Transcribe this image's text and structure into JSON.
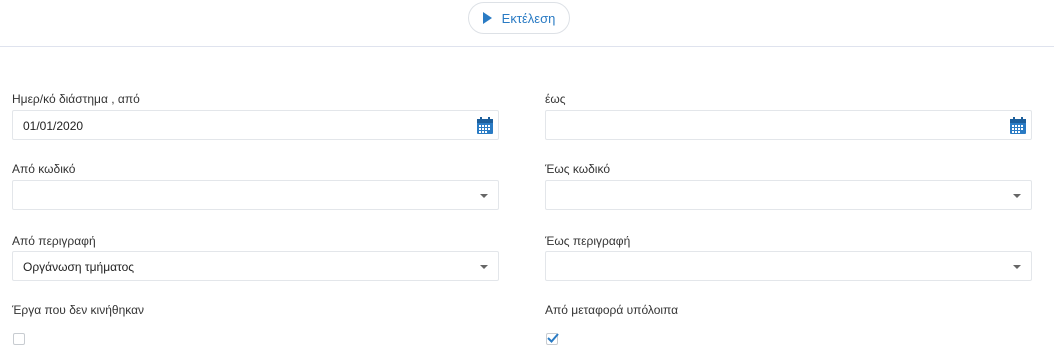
{
  "toolbar": {
    "run_label": "Εκτέλεση",
    "run_icon": "play-icon"
  },
  "form": {
    "date_from": {
      "label": "Ημερ/κό διάστημα , από",
      "value": "01/01/2020"
    },
    "date_to": {
      "label": "έως",
      "value": ""
    },
    "code_from": {
      "label": "Από κωδικό",
      "value": ""
    },
    "code_to": {
      "label": "Έως κωδικό",
      "value": ""
    },
    "desc_from": {
      "label": "Από περιγραφή",
      "value": "Οργάνωση τμήματος"
    },
    "desc_to": {
      "label": "Έως περιγραφή",
      "value": ""
    },
    "unmoved_projects": {
      "label": "Έργα που δεν κινήθηκαν",
      "checked": false
    },
    "carried_balances": {
      "label": "Από μεταφορά υπόλοιπα",
      "checked": true
    }
  },
  "colors": {
    "accent": "#2a7bc4",
    "border": "#e3e6ea"
  }
}
